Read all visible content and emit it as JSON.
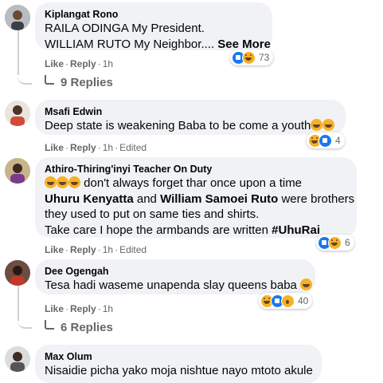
{
  "comments": [
    {
      "author": "Kiplangat Rono",
      "line1": "RAILA ODINGA My President.",
      "line2": "WILLIAM RUTO My Neighbor....",
      "see_more": "See More",
      "like": "Like",
      "reply": "Reply",
      "time": "1h",
      "reaction_count": "73",
      "replies": "9 Replies"
    },
    {
      "author": "Msafi Edwin",
      "line1": "Deep state is weakening Baba to be come a youth",
      "like": "Like",
      "reply": "Reply",
      "time": "1h",
      "edited": "Edited",
      "reaction_count": "4"
    },
    {
      "author": "Athiro-Thiring'inyi Teacher On Duty",
      "line1": " don't always forget thar once upon a time",
      "line2_a": "Uhuru Kenyatta",
      "line2_b": " and ",
      "line2_c": "William Samoei Ruto",
      "line2_d": " were brothers",
      "line3": "they used to put on same ties and shirts.",
      "line4": "Take care I hope the armbands are written ",
      "hashtag": "#UhuRai",
      "like": "Like",
      "reply": "Reply",
      "time": "1h",
      "edited": "Edited",
      "reaction_count": "6"
    },
    {
      "author": "Dee Ogengah",
      "line1": "Tesa hadi waseme unapenda slay queens baba ",
      "like": "Like",
      "reply": "Reply",
      "time": "1h",
      "reaction_count": "40",
      "replies": "6 Replies"
    },
    {
      "author": "Max Olum",
      "line1": "Nisaidie picha yako moja nishtue nayo mtoto akule"
    }
  ],
  "separator": "·"
}
